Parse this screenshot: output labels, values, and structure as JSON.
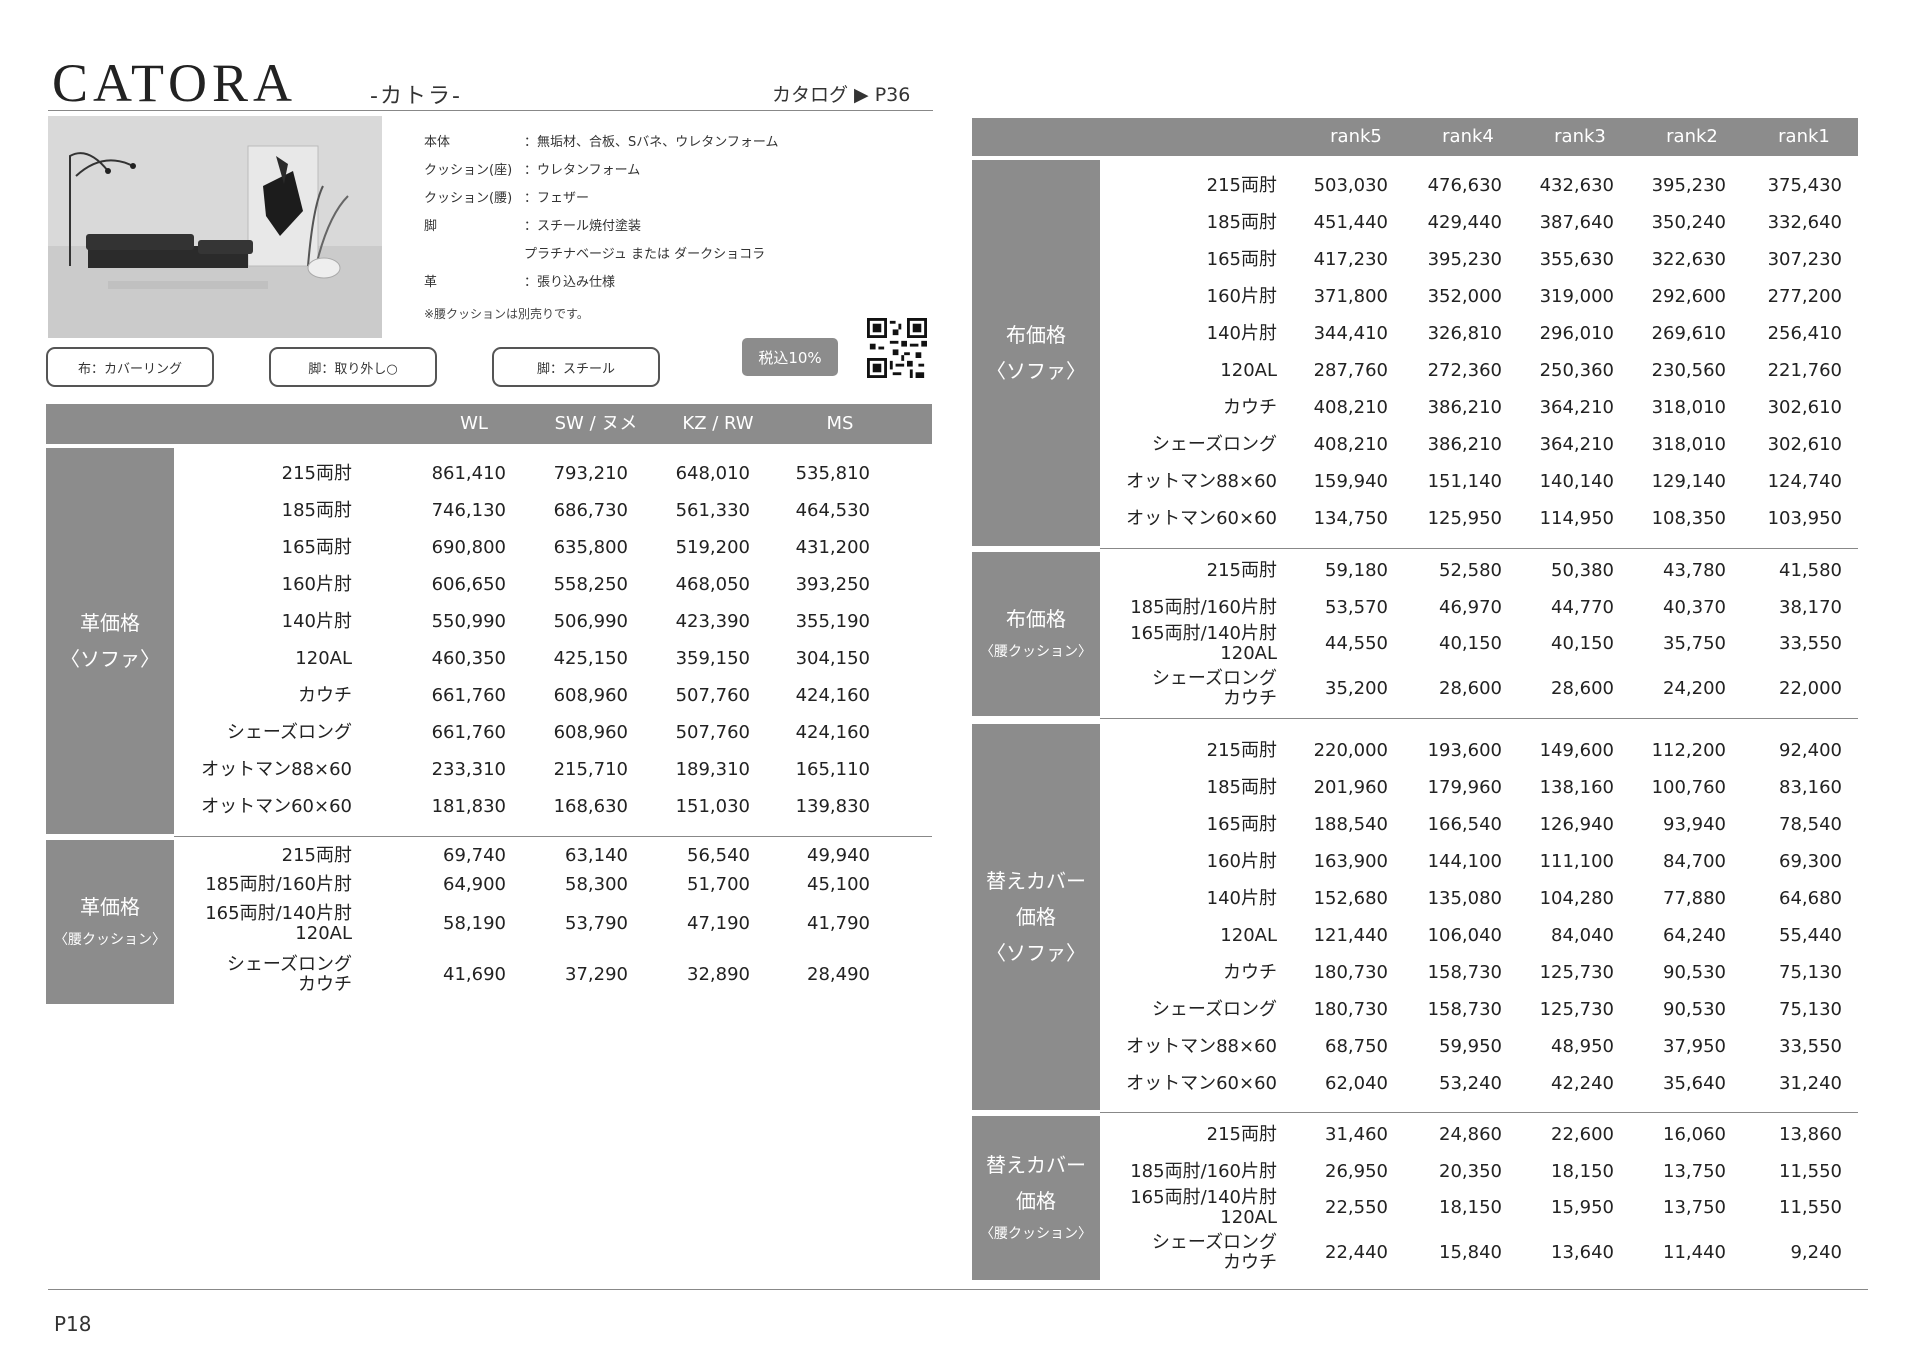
{
  "header": {
    "brand": "CATORA",
    "brand_sub": "-カトラ-",
    "catalog_ref": "カタログ ▶ P36"
  },
  "specs": [
    {
      "label": "本体",
      "value": "：無垢材、合板、Sバネ、ウレタンフォーム"
    },
    {
      "label": "クッション(座)",
      "value": "：ウレタンフォーム"
    },
    {
      "label": "クッション(腰)",
      "value": "：フェザー"
    },
    {
      "label": "脚",
      "value": "：スチール焼付塗装"
    },
    {
      "label": "",
      "value": "プラチナベージュ または ダークショコラ"
    },
    {
      "label": "革",
      "value": "：張り込み仕様"
    }
  ],
  "spec_note": "※腰クッションは別売りです。",
  "tags": [
    "布：カバーリング",
    "脚：取り外し○",
    "脚：スチール"
  ],
  "tax_badge": "税込10%",
  "left_table": {
    "columns": [
      "WL",
      "SW / ヌメ",
      "KZ / RW",
      "MS"
    ],
    "groups": [
      {
        "title": [
          "革価格",
          "〈ソファ〉"
        ],
        "rows": [
          {
            "label": [
              "215両肘"
            ],
            "values": [
              "861,410",
              "793,210",
              "648,010",
              "535,810"
            ]
          },
          {
            "label": [
              "185両肘"
            ],
            "values": [
              "746,130",
              "686,730",
              "561,330",
              "464,530"
            ]
          },
          {
            "label": [
              "165両肘"
            ],
            "values": [
              "690,800",
              "635,800",
              "519,200",
              "431,200"
            ]
          },
          {
            "label": [
              "160片肘"
            ],
            "values": [
              "606,650",
              "558,250",
              "468,050",
              "393,250"
            ]
          },
          {
            "label": [
              "140片肘"
            ],
            "values": [
              "550,990",
              "506,990",
              "423,390",
              "355,190"
            ]
          },
          {
            "label": [
              "120AL"
            ],
            "values": [
              "460,350",
              "425,150",
              "359,150",
              "304,150"
            ]
          },
          {
            "label": [
              "カウチ"
            ],
            "values": [
              "661,760",
              "608,960",
              "507,760",
              "424,160"
            ]
          },
          {
            "label": [
              "シェーズロング"
            ],
            "values": [
              "661,760",
              "608,960",
              "507,760",
              "424,160"
            ]
          },
          {
            "label": [
              "オットマン88×60"
            ],
            "values": [
              "233,310",
              "215,710",
              "189,310",
              "165,110"
            ]
          },
          {
            "label": [
              "オットマン60×60"
            ],
            "values": [
              "181,830",
              "168,630",
              "151,030",
              "139,830"
            ]
          }
        ]
      },
      {
        "title": [
          "革価格",
          "〈腰クッション〉"
        ],
        "rows": [
          {
            "label": [
              "215両肘"
            ],
            "values": [
              "69,740",
              "63,140",
              "56,540",
              "49,940"
            ]
          },
          {
            "label": [
              "185両肘/160片肘"
            ],
            "values": [
              "64,900",
              "58,300",
              "51,700",
              "45,100"
            ]
          },
          {
            "label": [
              "165両肘/140片肘",
              "120AL"
            ],
            "values": [
              "58,190",
              "53,790",
              "47,190",
              "41,790"
            ]
          },
          {
            "label": [
              "シェーズロング",
              "カウチ"
            ],
            "values": [
              "41,690",
              "37,290",
              "32,890",
              "28,490"
            ]
          }
        ]
      }
    ]
  },
  "right_table": {
    "columns": [
      "rank5",
      "rank4",
      "rank3",
      "rank2",
      "rank1"
    ],
    "groups": [
      {
        "title": [
          "布価格",
          "〈ソファ〉"
        ],
        "rows": [
          {
            "label": [
              "215両肘"
            ],
            "values": [
              "503,030",
              "476,630",
              "432,630",
              "395,230",
              "375,430"
            ]
          },
          {
            "label": [
              "185両肘"
            ],
            "values": [
              "451,440",
              "429,440",
              "387,640",
              "350,240",
              "332,640"
            ]
          },
          {
            "label": [
              "165両肘"
            ],
            "values": [
              "417,230",
              "395,230",
              "355,630",
              "322,630",
              "307,230"
            ]
          },
          {
            "label": [
              "160片肘"
            ],
            "values": [
              "371,800",
              "352,000",
              "319,000",
              "292,600",
              "277,200"
            ]
          },
          {
            "label": [
              "140片肘"
            ],
            "values": [
              "344,410",
              "326,810",
              "296,010",
              "269,610",
              "256,410"
            ]
          },
          {
            "label": [
              "120AL"
            ],
            "values": [
              "287,760",
              "272,360",
              "250,360",
              "230,560",
              "221,760"
            ]
          },
          {
            "label": [
              "カウチ"
            ],
            "values": [
              "408,210",
              "386,210",
              "364,210",
              "318,010",
              "302,610"
            ]
          },
          {
            "label": [
              "シェーズロング"
            ],
            "values": [
              "408,210",
              "386,210",
              "364,210",
              "318,010",
              "302,610"
            ]
          },
          {
            "label": [
              "オットマン88×60"
            ],
            "values": [
              "159,940",
              "151,140",
              "140,140",
              "129,140",
              "124,740"
            ]
          },
          {
            "label": [
              "オットマン60×60"
            ],
            "values": [
              "134,750",
              "125,950",
              "114,950",
              "108,350",
              "103,950"
            ]
          }
        ]
      },
      {
        "title": [
          "布価格",
          "〈腰クッション〉"
        ],
        "rows": [
          {
            "label": [
              "215両肘"
            ],
            "values": [
              "59,180",
              "52,580",
              "50,380",
              "43,780",
              "41,580"
            ]
          },
          {
            "label": [
              "185両肘/160片肘"
            ],
            "values": [
              "53,570",
              "46,970",
              "44,770",
              "40,370",
              "38,170"
            ]
          },
          {
            "label": [
              "165両肘/140片肘",
              "120AL"
            ],
            "values": [
              "44,550",
              "40,150",
              "40,150",
              "35,750",
              "33,550"
            ]
          },
          {
            "label": [
              "シェーズロング",
              "カウチ"
            ],
            "values": [
              "35,200",
              "28,600",
              "28,600",
              "24,200",
              "22,000"
            ]
          }
        ]
      },
      {
        "title": [
          "替えカバー",
          "価格",
          "〈ソファ〉"
        ],
        "rows": [
          {
            "label": [
              "215両肘"
            ],
            "values": [
              "220,000",
              "193,600",
              "149,600",
              "112,200",
              "92,400"
            ]
          },
          {
            "label": [
              "185両肘"
            ],
            "values": [
              "201,960",
              "179,960",
              "138,160",
              "100,760",
              "83,160"
            ]
          },
          {
            "label": [
              "165両肘"
            ],
            "values": [
              "188,540",
              "166,540",
              "126,940",
              "93,940",
              "78,540"
            ]
          },
          {
            "label": [
              "160片肘"
            ],
            "values": [
              "163,900",
              "144,100",
              "111,100",
              "84,700",
              "69,300"
            ]
          },
          {
            "label": [
              "140片肘"
            ],
            "values": [
              "152,680",
              "135,080",
              "104,280",
              "77,880",
              "64,680"
            ]
          },
          {
            "label": [
              "120AL"
            ],
            "values": [
              "121,440",
              "106,040",
              "84,040",
              "64,240",
              "55,440"
            ]
          },
          {
            "label": [
              "カウチ"
            ],
            "values": [
              "180,730",
              "158,730",
              "125,730",
              "90,530",
              "75,130"
            ]
          },
          {
            "label": [
              "シェーズロング"
            ],
            "values": [
              "180,730",
              "158,730",
              "125,730",
              "90,530",
              "75,130"
            ]
          },
          {
            "label": [
              "オットマン88×60"
            ],
            "values": [
              "68,750",
              "59,950",
              "48,950",
              "37,950",
              "33,550"
            ]
          },
          {
            "label": [
              "オットマン60×60"
            ],
            "values": [
              "62,040",
              "53,240",
              "42,240",
              "35,640",
              "31,240"
            ]
          }
        ]
      },
      {
        "title": [
          "替えカバー",
          "価格",
          "〈腰クッション〉"
        ],
        "rows": [
          {
            "label": [
              "215両肘"
            ],
            "values": [
              "31,460",
              "24,860",
              "22,600",
              "16,060",
              "13,860"
            ]
          },
          {
            "label": [
              "185両肘/160片肘"
            ],
            "values": [
              "26,950",
              "20,350",
              "18,150",
              "13,750",
              "11,550"
            ]
          },
          {
            "label": [
              "165両肘/140片肘",
              "120AL"
            ],
            "values": [
              "22,550",
              "18,150",
              "15,950",
              "13,750",
              "11,550"
            ]
          },
          {
            "label": [
              "シェーズロング",
              "カウチ"
            ],
            "values": [
              "22,440",
              "15,840",
              "13,640",
              "11,440",
              "9,240"
            ]
          }
        ]
      }
    ]
  },
  "footer": {
    "page": "P18"
  }
}
